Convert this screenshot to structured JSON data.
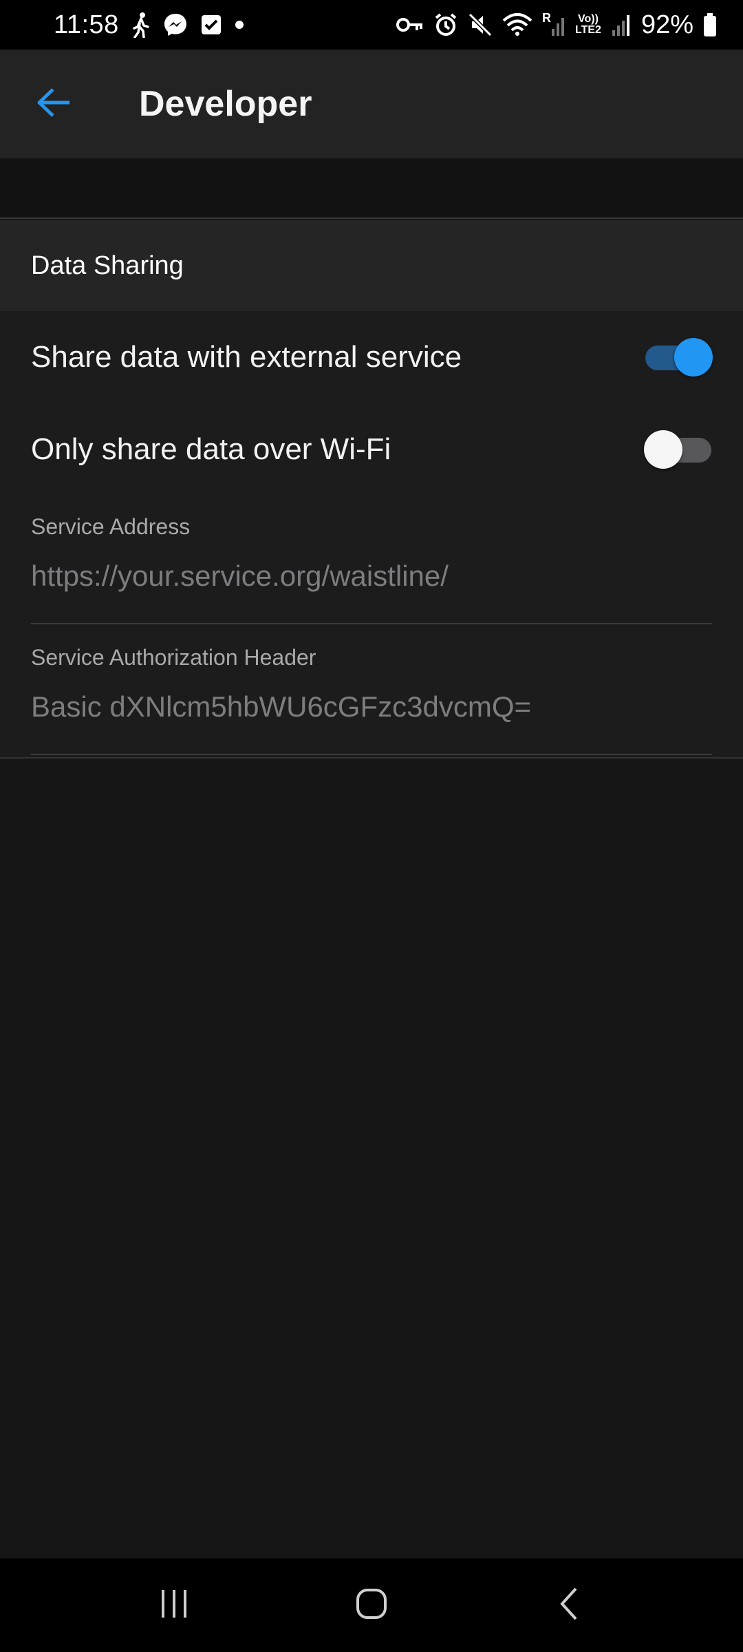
{
  "status_bar": {
    "time": "11:58",
    "battery": "92%",
    "left_icons": [
      "walk-icon",
      "messenger-icon",
      "task-check-icon",
      "dot-icon"
    ],
    "right_icons": [
      "vpn-key-icon",
      "alarm-icon",
      "mute-icon",
      "wifi-icon",
      "signal-roaming-icon",
      "volte-lte2-icon",
      "signal-icon",
      "battery-icon"
    ],
    "roaming_label": "R",
    "volte_label": "Vo))",
    "lte_label": "LTE2"
  },
  "app_bar": {
    "title": "Developer",
    "back_icon": "arrow-back-icon",
    "accent": "#2196f3"
  },
  "section": {
    "title": "Data Sharing"
  },
  "toggles": [
    {
      "label": "Share data with external service",
      "checked": true
    },
    {
      "label": "Only share data over Wi-Fi",
      "checked": false
    }
  ],
  "fields": [
    {
      "label": "Service Address",
      "value": "",
      "placeholder": "https://your.service.org/waistline/"
    },
    {
      "label": "Service Authorization Header",
      "value": "",
      "placeholder": "Basic dXNlcm5hbWU6cGFzc3dvcmQ="
    }
  ],
  "nav_bar": {
    "icons": [
      "recent-apps-icon",
      "home-icon",
      "nav-back-icon"
    ]
  }
}
